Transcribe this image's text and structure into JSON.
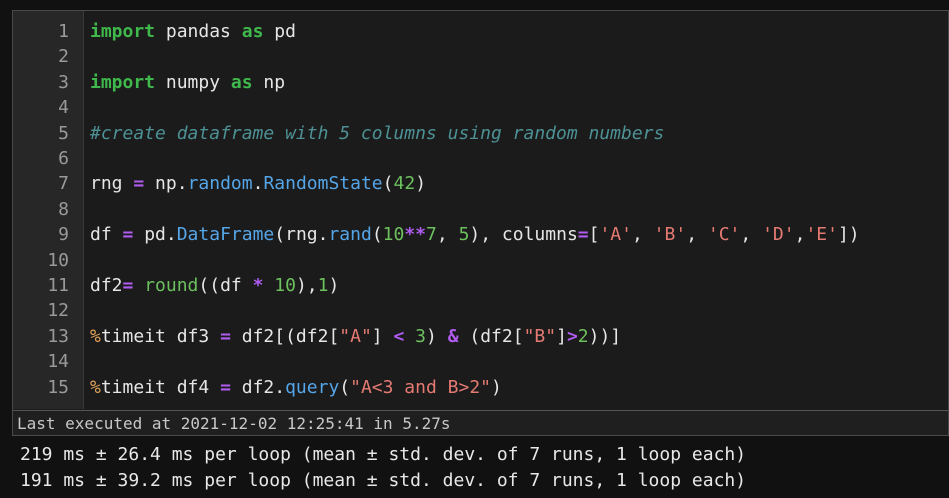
{
  "cell": {
    "line_numbers": [
      "1",
      "2",
      "3",
      "4",
      "5",
      "6",
      "7",
      "8",
      "9",
      "10",
      "11",
      "12",
      "13",
      "14",
      "15"
    ],
    "lines": [
      {
        "tokens": [
          {
            "t": "import",
            "c": "kw"
          },
          {
            "t": " pandas ",
            "c": "plain"
          },
          {
            "t": "as",
            "c": "kw"
          },
          {
            "t": " pd",
            "c": "plain"
          }
        ]
      },
      {
        "tokens": []
      },
      {
        "tokens": [
          {
            "t": "import",
            "c": "kw"
          },
          {
            "t": " numpy ",
            "c": "plain"
          },
          {
            "t": "as",
            "c": "kw"
          },
          {
            "t": " np",
            "c": "plain"
          }
        ]
      },
      {
        "tokens": []
      },
      {
        "tokens": [
          {
            "t": "#create dataframe with 5 columns using random numbers",
            "c": "cmt"
          }
        ]
      },
      {
        "tokens": []
      },
      {
        "tokens": [
          {
            "t": "rng ",
            "c": "plain"
          },
          {
            "t": "=",
            "c": "op"
          },
          {
            "t": " np.",
            "c": "plain"
          },
          {
            "t": "random",
            "c": "fn"
          },
          {
            "t": ".",
            "c": "plain"
          },
          {
            "t": "RandomState",
            "c": "fn"
          },
          {
            "t": "(",
            "c": "plain"
          },
          {
            "t": "42",
            "c": "num"
          },
          {
            "t": ")",
            "c": "plain"
          }
        ]
      },
      {
        "tokens": []
      },
      {
        "tokens": [
          {
            "t": "df ",
            "c": "plain"
          },
          {
            "t": "=",
            "c": "op"
          },
          {
            "t": " pd.",
            "c": "plain"
          },
          {
            "t": "DataFrame",
            "c": "fn"
          },
          {
            "t": "(rng.",
            "c": "plain"
          },
          {
            "t": "rand",
            "c": "fn"
          },
          {
            "t": "(",
            "c": "plain"
          },
          {
            "t": "10",
            "c": "num"
          },
          {
            "t": "**",
            "c": "op"
          },
          {
            "t": "7",
            "c": "num"
          },
          {
            "t": ", ",
            "c": "plain"
          },
          {
            "t": "5",
            "c": "num"
          },
          {
            "t": "), columns",
            "c": "plain"
          },
          {
            "t": "=",
            "c": "op"
          },
          {
            "t": "[",
            "c": "plain"
          },
          {
            "t": "'A'",
            "c": "str"
          },
          {
            "t": ", ",
            "c": "plain"
          },
          {
            "t": "'B'",
            "c": "str"
          },
          {
            "t": ", ",
            "c": "plain"
          },
          {
            "t": "'C'",
            "c": "str"
          },
          {
            "t": ", ",
            "c": "plain"
          },
          {
            "t": "'D'",
            "c": "str"
          },
          {
            "t": ",",
            "c": "plain"
          },
          {
            "t": "'E'",
            "c": "str"
          },
          {
            "t": "])",
            "c": "plain"
          }
        ]
      },
      {
        "tokens": []
      },
      {
        "tokens": [
          {
            "t": "df2",
            "c": "plain"
          },
          {
            "t": "=",
            "c": "op"
          },
          {
            "t": " ",
            "c": "plain"
          },
          {
            "t": "round",
            "c": "num"
          },
          {
            "t": "((df ",
            "c": "plain"
          },
          {
            "t": "*",
            "c": "op"
          },
          {
            "t": " ",
            "c": "plain"
          },
          {
            "t": "10",
            "c": "num"
          },
          {
            "t": "),",
            "c": "plain"
          },
          {
            "t": "1",
            "c": "num"
          },
          {
            "t": ")",
            "c": "plain"
          }
        ]
      },
      {
        "tokens": []
      },
      {
        "tokens": [
          {
            "t": "%",
            "c": "pct"
          },
          {
            "t": "timeit df3 ",
            "c": "plain"
          },
          {
            "t": "=",
            "c": "op"
          },
          {
            "t": " df2[(df2[",
            "c": "plain"
          },
          {
            "t": "\"A\"",
            "c": "str"
          },
          {
            "t": "] ",
            "c": "plain"
          },
          {
            "t": "<",
            "c": "op"
          },
          {
            "t": " ",
            "c": "plain"
          },
          {
            "t": "3",
            "c": "num"
          },
          {
            "t": ") ",
            "c": "plain"
          },
          {
            "t": "&",
            "c": "op"
          },
          {
            "t": " (df2[",
            "c": "plain"
          },
          {
            "t": "\"B\"",
            "c": "str"
          },
          {
            "t": "]",
            "c": "plain"
          },
          {
            "t": ">",
            "c": "op"
          },
          {
            "t": "2",
            "c": "num"
          },
          {
            "t": "))]",
            "c": "plain"
          }
        ]
      },
      {
        "tokens": []
      },
      {
        "tokens": [
          {
            "t": "%",
            "c": "pct"
          },
          {
            "t": "timeit df4 ",
            "c": "plain"
          },
          {
            "t": "=",
            "c": "op"
          },
          {
            "t": " df2.",
            "c": "plain"
          },
          {
            "t": "query",
            "c": "fn"
          },
          {
            "t": "(",
            "c": "plain"
          },
          {
            "t": "\"A<3 and B>2\"",
            "c": "str"
          },
          {
            "t": ")",
            "c": "plain"
          }
        ]
      }
    ],
    "status": "Last executed at 2021-12-02 12:25:41 in 5.27s"
  },
  "output": {
    "lines": [
      "219 ms ± 26.4 ms per loop (mean ± std. dev. of 7 runs, 1 loop each)",
      "191 ms ± 39.2 ms per loop (mean ± std. dev. of 7 runs, 1 loop each)"
    ]
  },
  "colors": {
    "keyword": "#3fb84c",
    "function": "#55a6e8",
    "operator": "#b05cf0",
    "number": "#6cc15e",
    "string": "#e57a73",
    "comment": "#4d9195",
    "magic": "#e0a35a"
  }
}
